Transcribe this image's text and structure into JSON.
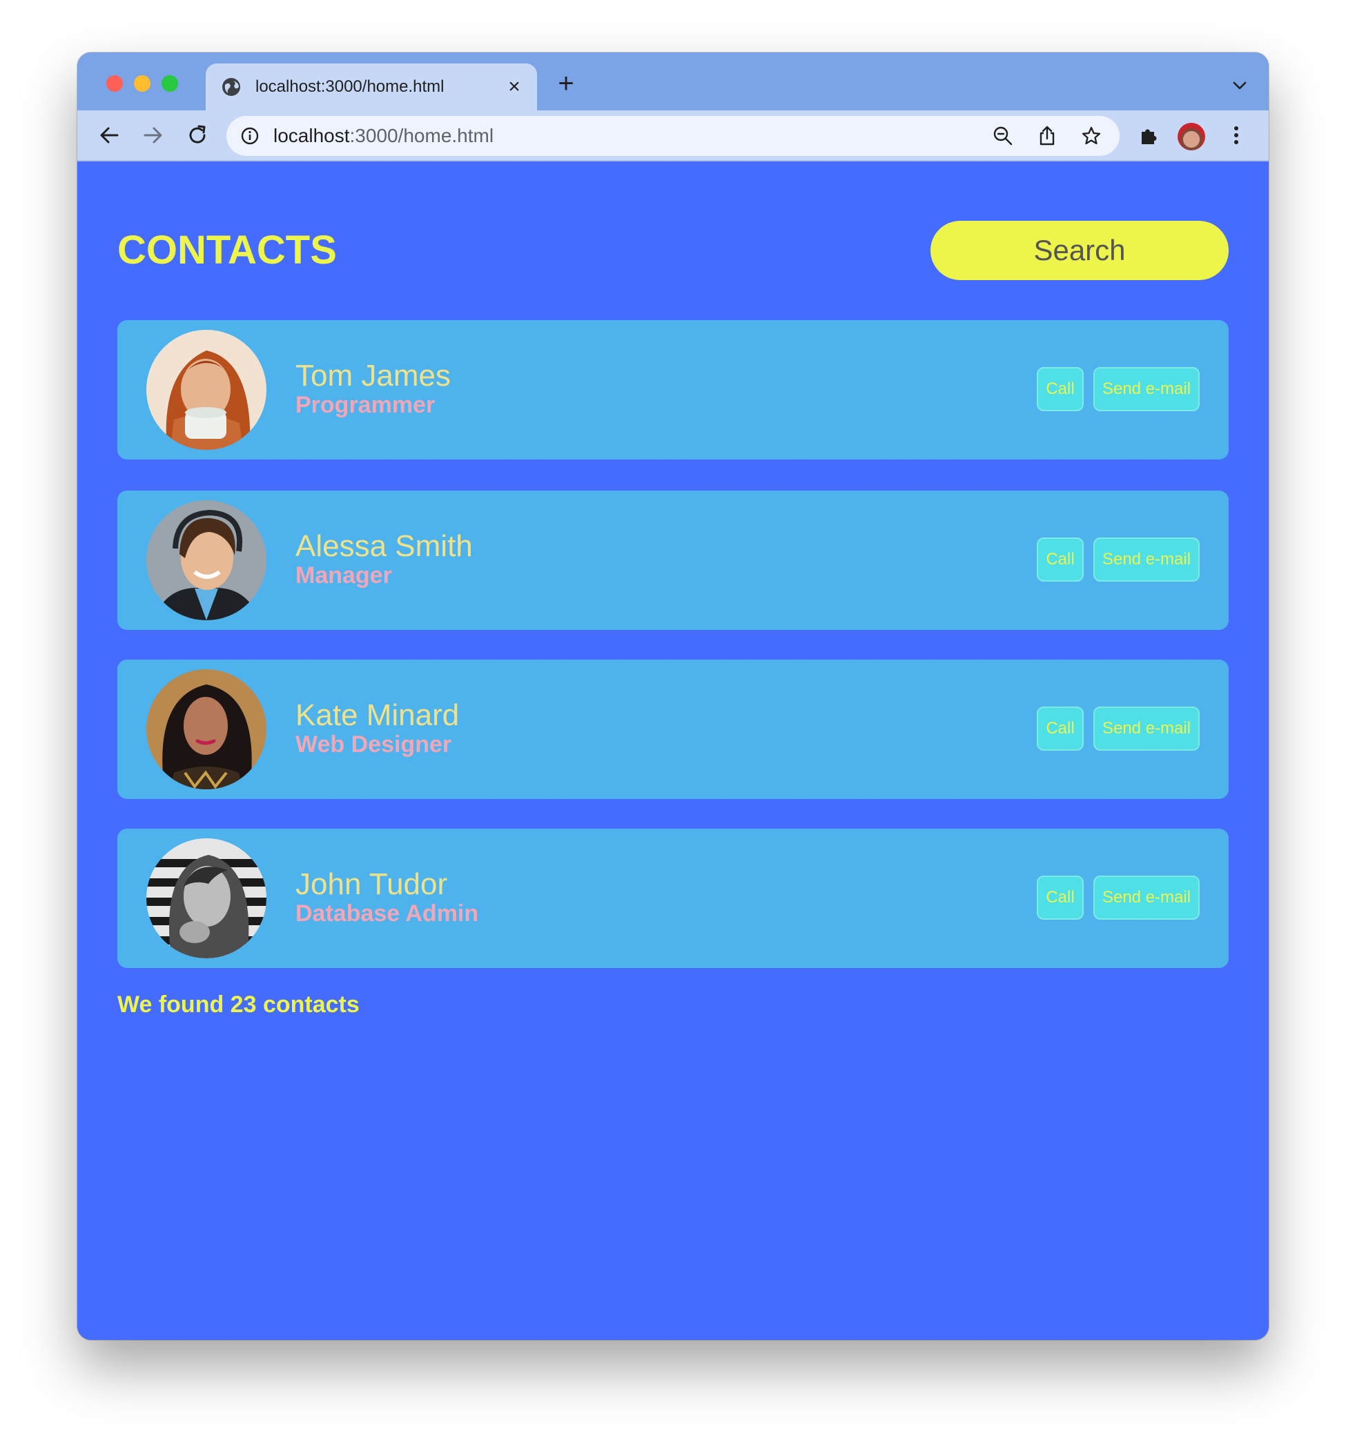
{
  "browser": {
    "tab_title": "localhost:3000/home.html",
    "url_host": "localhost",
    "url_path": ":3000/home.html"
  },
  "page": {
    "heading": "CONTACTS",
    "search_label": "Search",
    "contacts": [
      {
        "name": "Tom James",
        "role": "Programmer",
        "call_label": "Call",
        "email_label": "Send e-mail"
      },
      {
        "name": "Alessa Smith",
        "role": "Manager",
        "call_label": "Call",
        "email_label": "Send e-mail"
      },
      {
        "name": "Kate Minard",
        "role": "Web Designer",
        "call_label": "Call",
        "email_label": "Send e-mail"
      },
      {
        "name": "John Tudor",
        "role": "Database Admin",
        "call_label": "Call",
        "email_label": "Send e-mail"
      }
    ],
    "footer": "We found 23 contacts"
  },
  "colors": {
    "page_background": "#456bff",
    "heading": "#eef54a",
    "card_background": "#4eb3ec",
    "name": "#f0e28a",
    "role": "#f2a7b8",
    "action_button": "#4ee0e6"
  },
  "icons": [
    "globe-icon",
    "close-icon",
    "plus-icon",
    "chevron-down-icon",
    "back-icon",
    "forward-icon",
    "reload-icon",
    "info-icon",
    "zoom-out-icon",
    "share-icon",
    "star-icon",
    "extensions-icon",
    "kebab-menu-icon"
  ]
}
